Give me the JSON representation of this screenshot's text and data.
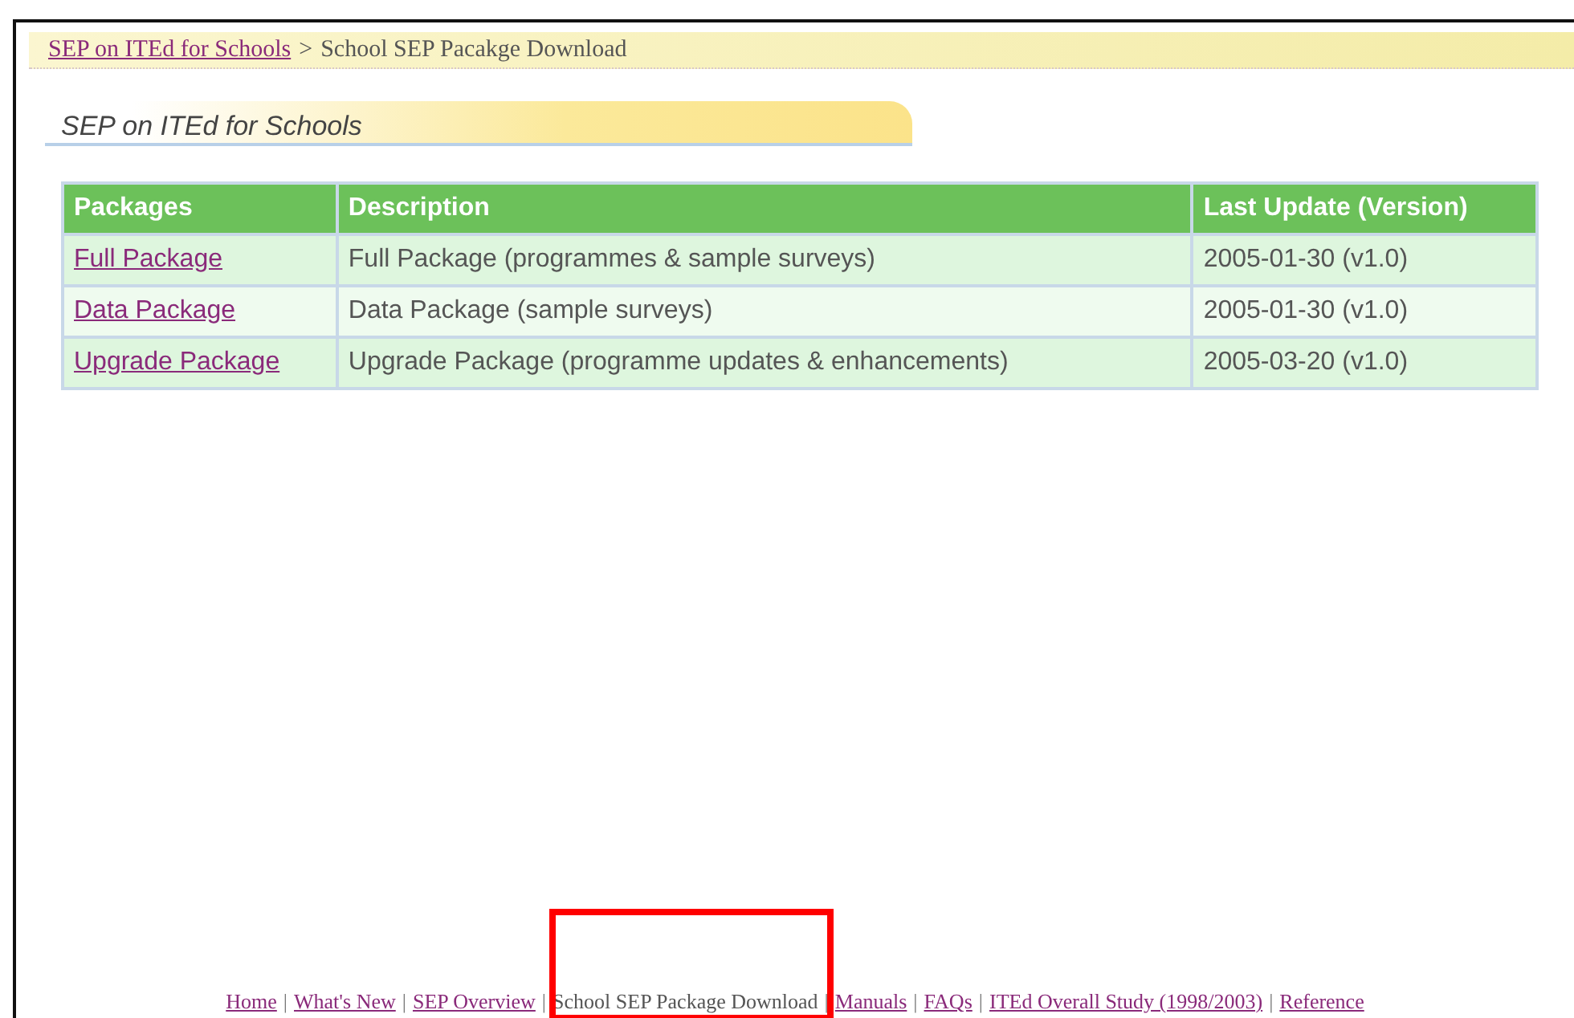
{
  "breadcrumb": {
    "link": "SEP on ITEd for Schools",
    "separator": ">",
    "current": "School SEP Pacakge Download"
  },
  "section_title": "SEP on ITEd for Schools",
  "table": {
    "columns": [
      "Packages",
      "Description",
      "Last Update (Version)"
    ],
    "rows": [
      {
        "package": "Full Package",
        "description": "Full Package (programmes & sample surveys)",
        "updated": "2005-01-30 (v1.0)"
      },
      {
        "package": "Data Package",
        "description": "Data Package (sample surveys)",
        "updated": "2005-01-30 (v1.0)"
      },
      {
        "package": "Upgrade Package",
        "description": "Upgrade Package (programme updates & enhancements)",
        "updated": "2005-03-20 (v1.0)"
      }
    ]
  },
  "footer_nav": [
    {
      "label": "Home",
      "kind": "link"
    },
    {
      "separator": "|",
      "label": "What's New",
      "kind": "link"
    },
    {
      "separator": "|",
      "label": "SEP Overview",
      "kind": "link"
    },
    {
      "separator": "|",
      "label": "School SEP Package Download",
      "kind": "current",
      "highlighted": true
    },
    {
      "separator": "|",
      "label": "Manuals",
      "kind": "link"
    },
    {
      "separator": "|",
      "label": "FAQs",
      "kind": "link"
    },
    {
      "separator": "|",
      "label": "ITEd Overall Study (1998/2003)",
      "kind": "link"
    },
    {
      "separator": "|",
      "label": "Reference",
      "kind": "link"
    }
  ]
}
